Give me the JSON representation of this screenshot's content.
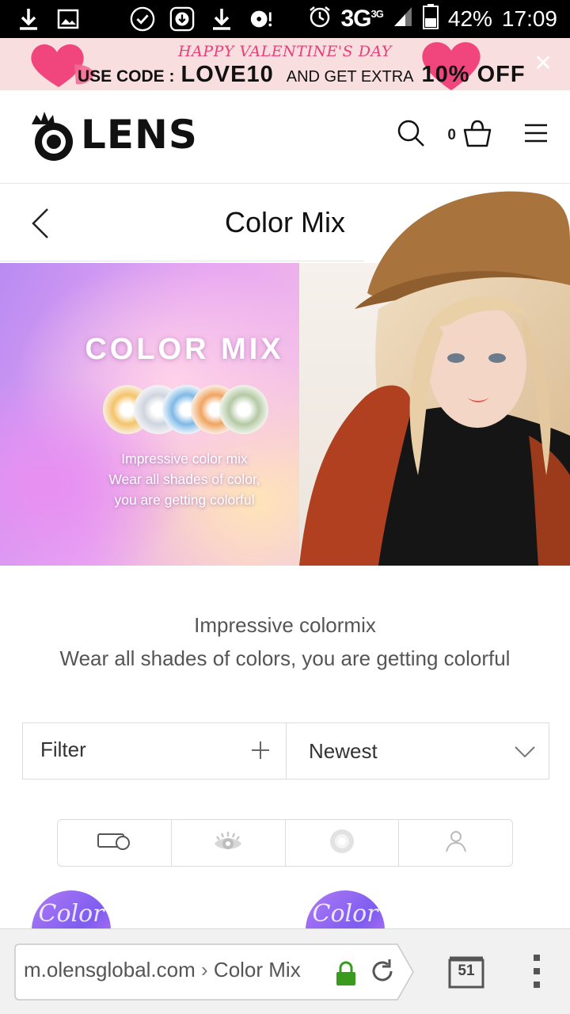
{
  "status_bar": {
    "network": "3G",
    "network_sup": "3G",
    "battery": "42%",
    "time": "17:09"
  },
  "promo": {
    "headline": "HAPPY VALENTINE'S DAY",
    "use_code_label": "USE CODE :",
    "code": "LOVE10",
    "middle": "AND GET EXTRA",
    "discount": "10% OFF",
    "close": "✕"
  },
  "header": {
    "logo": "LENS",
    "cart_count": "0"
  },
  "page": {
    "title": "Color Mix"
  },
  "hero": {
    "heading": "COLOR MIX",
    "sub_line1": "Impressive color mix",
    "sub_line2": "Wear all shades of color,",
    "sub_line3": "you are getting colorful"
  },
  "description": {
    "line1": "Impressive colormix",
    "line2": "Wear all shades of colors, you are getting colorful"
  },
  "controls": {
    "filter_label": "Filter",
    "sort_label": "Newest"
  },
  "icon_tabs": [
    "lens-case-icon",
    "eye-icon",
    "lens-icon",
    "person-icon"
  ],
  "products": {
    "badge1": "Color",
    "badge2": "Color"
  },
  "browser": {
    "domain": "m.olensglobal.com",
    "separator": "›",
    "path": "Color Mix",
    "tab_count": "51"
  },
  "colors": {
    "promo_bg": "#f8dede",
    "promo_pink": "#e8407a",
    "lock_green": "#3a9a1e"
  }
}
